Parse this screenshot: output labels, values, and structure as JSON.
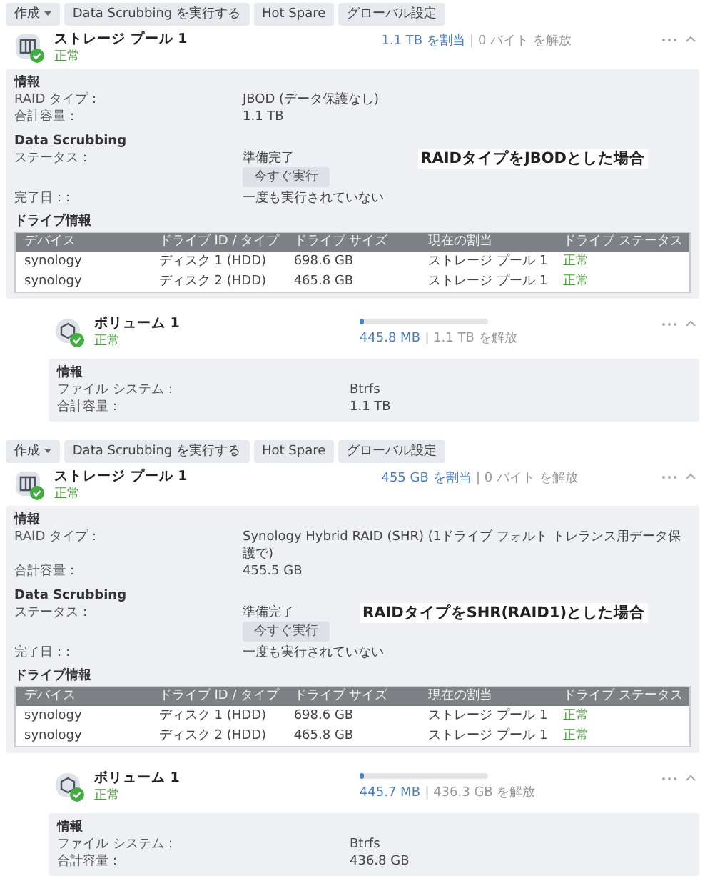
{
  "panels": [
    {
      "toolbar": [
        {
          "label": "作成",
          "caret": true
        },
        {
          "label": "Data Scrubbing を実行する",
          "caret": false
        },
        {
          "label": "Hot Spare",
          "caret": false
        },
        {
          "label": "グローバル設定",
          "caret": false
        }
      ],
      "pool": {
        "name": "ストレージ プール 1",
        "status": "正常",
        "allocated": "1.1 TB を割当",
        "free": "| 0 バイト を解放",
        "info_heading": "情報",
        "info": [
          {
            "label": "RAID タイプ：",
            "value": "JBOD (データ保護なし)"
          },
          {
            "label": "合計容量：",
            "value": "1.1 TB"
          }
        ],
        "scrubbing": {
          "heading": "Data Scrubbing",
          "status_label": "ステータス：",
          "status_value": "準備完了",
          "run_button": "今すぐ実行",
          "done_label": "完了日：:",
          "done_value": "一度も実行されていない"
        },
        "drives": {
          "heading": "ドライブ情報",
          "columns": [
            "デバイス",
            "ドライブ ID / タイプ",
            "ドライブ サイズ",
            "現在の割当",
            "ドライブ ステータス"
          ],
          "rows": [
            [
              "synology",
              "ディスク 1 (HDD)",
              "698.6 GB",
              "ストレージ プール 1",
              "正常"
            ],
            [
              "synology",
              "ディスク 2 (HDD)",
              "465.8 GB",
              "ストレージ プール 1",
              "正常"
            ]
          ]
        }
      },
      "annotation": "RAIDタイプをJBODとした場合",
      "volume": {
        "name": "ボリューム 1",
        "status": "正常",
        "level": 0.03,
        "used": "445.8 MB",
        "free": "| 1.1 TB を解放",
        "info_heading": "情報",
        "info": [
          {
            "label": "ファイル システム：",
            "value": "Btrfs"
          },
          {
            "label": "合計容量：",
            "value": "1.1 TB"
          }
        ]
      }
    },
    {
      "toolbar": [
        {
          "label": "作成",
          "caret": true
        },
        {
          "label": "Data Scrubbing を実行する",
          "caret": false
        },
        {
          "label": "Hot Spare",
          "caret": false
        },
        {
          "label": "グローバル設定",
          "caret": false
        }
      ],
      "pool": {
        "name": "ストレージ プール 1",
        "status": "正常",
        "allocated": "455 GB を割当",
        "free": "| 0 バイト を解放",
        "info_heading": "情報",
        "info": [
          {
            "label": "RAID タイプ：",
            "value": "Synology Hybrid RAID (SHR) (1ドライブ フォルト トレランス用データ保護で)"
          },
          {
            "label": "合計容量：",
            "value": "455.5 GB"
          }
        ],
        "scrubbing": {
          "heading": "Data Scrubbing",
          "status_label": "ステータス：",
          "status_value": "準備完了",
          "run_button": "今すぐ実行",
          "done_label": "完了日：:",
          "done_value": "一度も実行されていない"
        },
        "drives": {
          "heading": "ドライブ情報",
          "columns": [
            "デバイス",
            "ドライブ ID / タイプ",
            "ドライブ サイズ",
            "現在の割当",
            "ドライブ ステータス"
          ],
          "rows": [
            [
              "synology",
              "ディスク 1 (HDD)",
              "698.6 GB",
              "ストレージ プール 1",
              "正常"
            ],
            [
              "synology",
              "ディスク 2 (HDD)",
              "465.8 GB",
              "ストレージ プール 1",
              "正常"
            ]
          ]
        }
      },
      "annotation": "RAIDタイプをSHR(RAID1)とした場合",
      "volume": {
        "name": "ボリューム 1",
        "status": "正常",
        "level": 0.03,
        "used": "445.7 MB",
        "free": "| 436.3 GB を解放",
        "info_heading": "情報",
        "info": [
          {
            "label": "ファイル システム：",
            "value": "Btrfs"
          },
          {
            "label": "合計容量：",
            "value": "436.8 GB"
          }
        ]
      }
    }
  ]
}
